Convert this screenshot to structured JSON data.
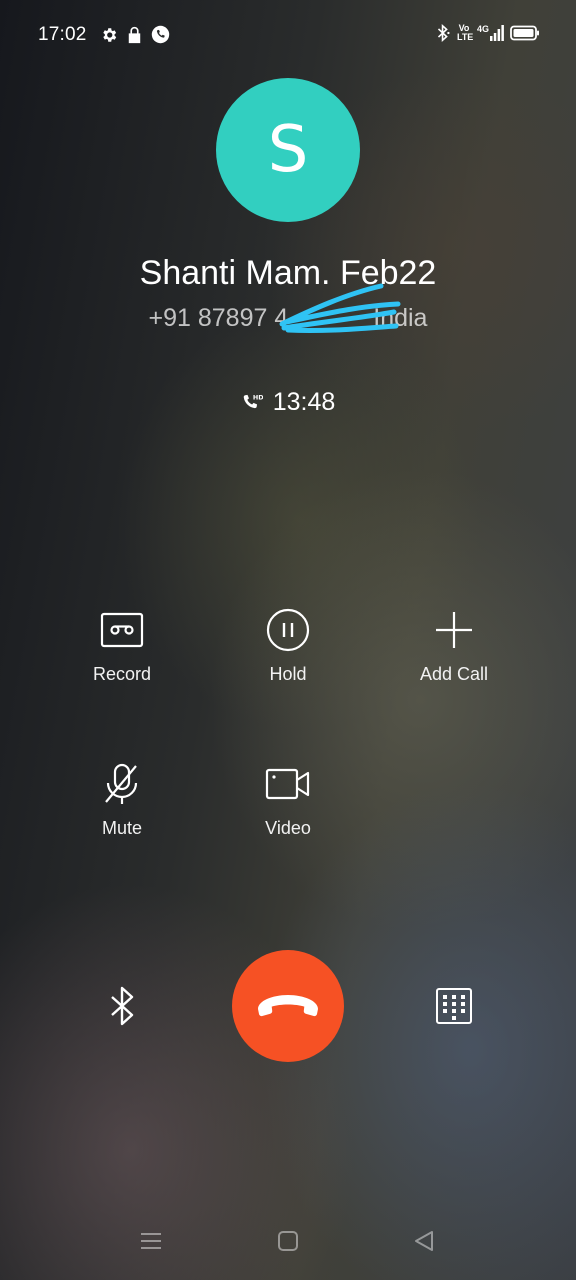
{
  "status_bar": {
    "time": "17:02",
    "left_icons": [
      "settings-gear-icon",
      "lock-icon",
      "phone-call-icon"
    ],
    "right_icons": [
      "bluetooth-icon",
      "volte-icon",
      "signal-4g-icon",
      "battery-icon"
    ],
    "volte_label_top": "Vo",
    "volte_label_bottom": "LTE",
    "network_label": "4G"
  },
  "contact": {
    "avatar_initial": "S",
    "avatar_color": "#32cfc0",
    "name": "Shanti Mam. Feb22",
    "number": "+91 87897 4",
    "number_location_suffix": "India",
    "number_redacted": true
  },
  "call": {
    "hd_label": "HD",
    "duration": "13:48"
  },
  "actions": {
    "record": "Record",
    "hold": "Hold",
    "add_call": "Add Call",
    "mute": "Mute",
    "video": "Video"
  },
  "bottom": {
    "bluetooth_icon": "bluetooth-icon",
    "end_call_icon": "hang-up-icon",
    "end_call_color": "#f65124",
    "keypad_icon": "dialpad-icon"
  },
  "navigation": [
    "menu-icon",
    "home-icon",
    "back-icon"
  ]
}
